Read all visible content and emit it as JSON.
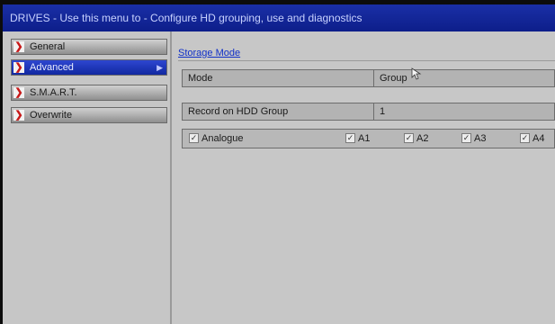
{
  "window": {
    "title": "DRIVES - Use this menu to - Configure HD grouping, use and diagnostics"
  },
  "sidebar": {
    "items": [
      {
        "label": "General",
        "active": false
      },
      {
        "label": "Advanced",
        "active": true
      },
      {
        "label": "S.M.A.R.T.",
        "active": false
      },
      {
        "label": "Overwrite",
        "active": false
      }
    ]
  },
  "main": {
    "section_title": "Storage Mode",
    "mode": {
      "label": "Mode",
      "value": "Group"
    },
    "record_group": {
      "label": "Record on HDD Group",
      "value": "1"
    },
    "cameras": {
      "master": {
        "label": "Analogue",
        "checked": true
      },
      "channels": [
        {
          "label": "A1",
          "checked": true
        },
        {
          "label": "A2",
          "checked": true
        },
        {
          "label": "A3",
          "checked": true
        },
        {
          "label": "A4",
          "checked": true
        }
      ]
    }
  },
  "icons": {
    "nav_arrow": "chevron-right-icon",
    "checkbox": "checkmark-icon",
    "pointer": "mouse-pointer-icon"
  },
  "colors": {
    "titlebar": "#1a2fa6",
    "active_nav": "#1f37c0",
    "arrow_red": "#c81818",
    "link_blue": "#1030c8"
  }
}
